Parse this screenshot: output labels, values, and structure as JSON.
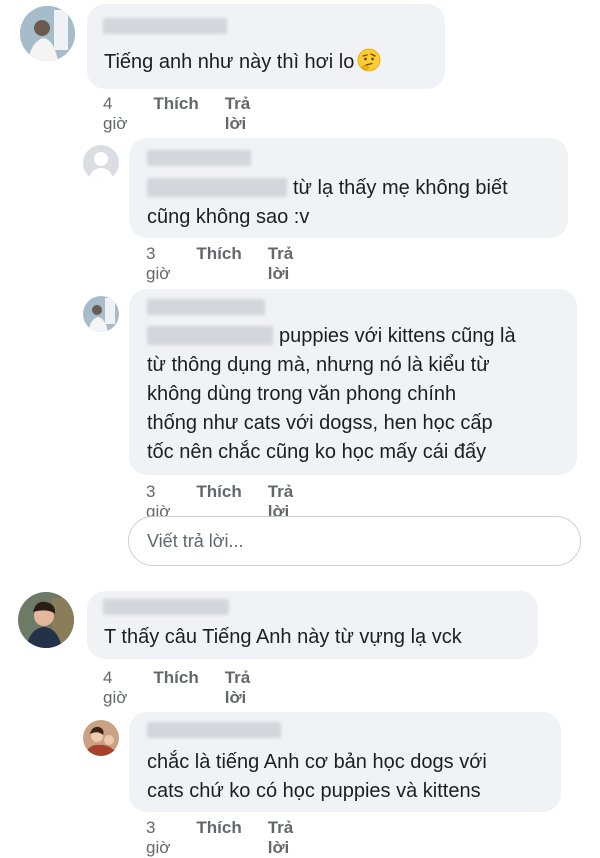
{
  "comments": [
    {
      "text": "Tiếng anh như này thì hơi lo",
      "emoji": "thinking-face-emoji",
      "time": "4 giờ",
      "like": "Thích",
      "reply": "Trả lời"
    },
    {
      "text_line1": "từ lạ thấy mẹ không biết",
      "text_line2": "cũng không sao :v",
      "time": "3 giờ",
      "like": "Thích",
      "reply": "Trả lời"
    },
    {
      "text_line1": "puppies với kittens cũng là",
      "text_rest": "từ thông dụng mà, nhưng nó là kiểu từ\nkhông dùng trong văn phong chính\nthống như cats với dogss, hen học cấp\ntốc nên chắc cũng ko học mấy cái đấy",
      "time": "3 giờ",
      "like": "Thích",
      "reply": "Trả lời"
    },
    {
      "text": "T thấy câu Tiếng Anh này từ vựng lạ vck",
      "time": "4 giờ",
      "like": "Thích",
      "reply": "Trả lời"
    },
    {
      "text": "chắc là tiếng Anh cơ bản học dogs với\ncats chứ ko có học puppies và kittens",
      "time": "3 giờ",
      "like": "Thích",
      "reply": "Trả lời"
    }
  ],
  "reply_input": {
    "placeholder": "Viết trả lời..."
  },
  "colors": {
    "bubble": "#f0f2f5",
    "meta_text": "#65676b",
    "text": "#1c1e21"
  }
}
